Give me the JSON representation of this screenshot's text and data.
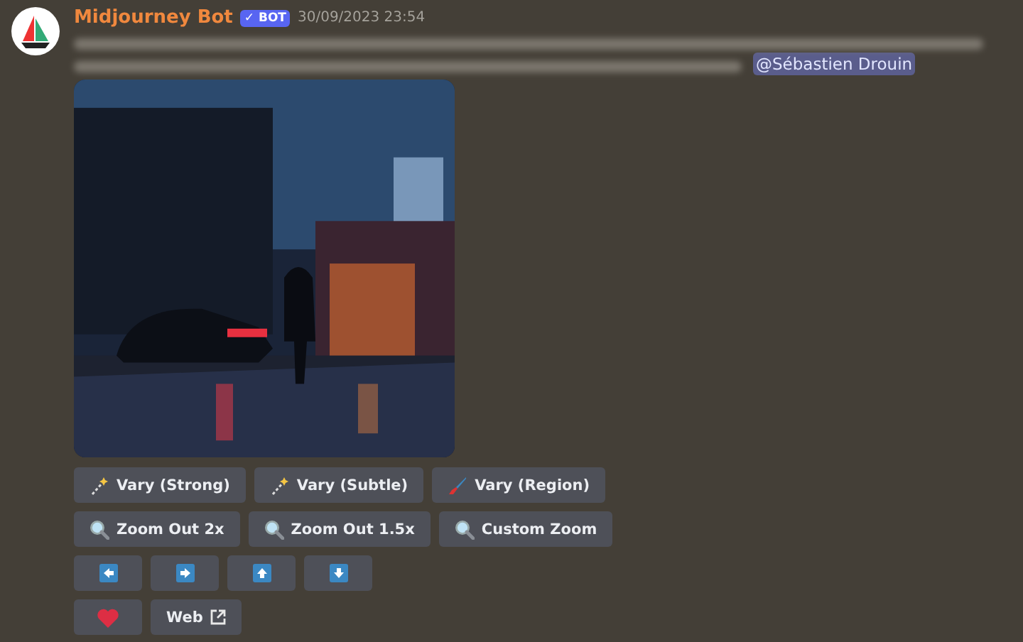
{
  "message": {
    "author": "Midjourney Bot",
    "badge": "✓ BOT",
    "timestamp": "30/09/2023 23:54",
    "mention": "@Sébastien Drouin"
  },
  "button_rows": [
    [
      {
        "kind": "sparkle",
        "label": "Vary (Strong)"
      },
      {
        "kind": "sparkle",
        "label": "Vary (Subtle)"
      },
      {
        "kind": "brush",
        "label": "Vary (Region)"
      }
    ],
    [
      {
        "kind": "zoom",
        "label": "Zoom Out 2x"
      },
      {
        "kind": "zoom",
        "label": "Zoom Out 1.5x"
      },
      {
        "kind": "zoom",
        "label": "Custom Zoom"
      }
    ],
    [
      {
        "kind": "left"
      },
      {
        "kind": "right"
      },
      {
        "kind": "up"
      },
      {
        "kind": "down"
      }
    ],
    [
      {
        "kind": "heart"
      },
      {
        "kind": "web",
        "label": "Web"
      }
    ]
  ]
}
